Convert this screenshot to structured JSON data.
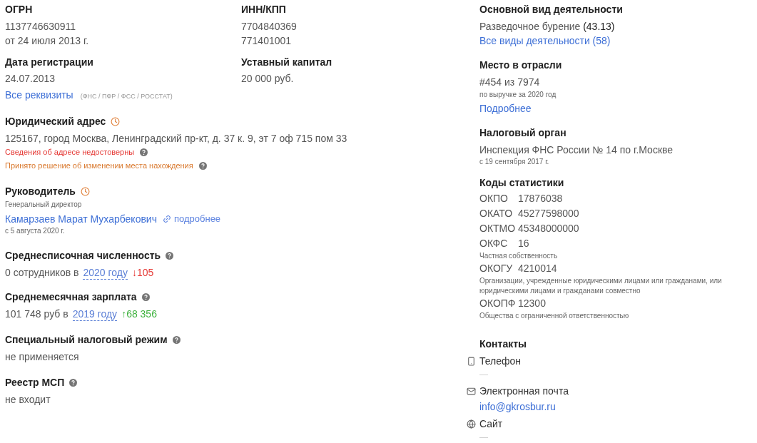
{
  "ogrn": {
    "label": "ОГРН",
    "value": "1137746630911",
    "date": "от 24 июля 2013 г."
  },
  "inn_kpp": {
    "label": "ИНН/КПП",
    "inn": "7704840369",
    "kpp": "771401001"
  },
  "registration": {
    "label": "Дата регистрации",
    "value": "24.07.2013"
  },
  "capital": {
    "label": "Уставный капитал",
    "value": "20 000 руб."
  },
  "requisites": {
    "link": "Все реквизиты",
    "sources": "(ФНС / ПФР / ФСС / РОССТАТ)"
  },
  "address": {
    "label": "Юридический адрес",
    "value": "125167, город Москва, Ленинградский пр-кт, д. 37 к. 9, эт 7 оф 715 пом 33",
    "warnings": [
      {
        "text": "Сведения об адресе недостоверны",
        "color": "#e53935"
      },
      {
        "text": "Принято решение об изменении места нахождения",
        "color": "#d9782d"
      }
    ]
  },
  "director": {
    "label": "Руководитель",
    "position": "Генеральный директор",
    "name": "Камарзаев Марат Мухарбекович",
    "more": "подробнее",
    "since": "с 5 августа 2020 г."
  },
  "metrics": [
    {
      "label": "Среднесписочная численность",
      "prefix": "0 сотрудников в",
      "year": "2020 году",
      "delta": "↓105",
      "color": "#e53935"
    },
    {
      "label": "Среднемесячная зарплата",
      "prefix": "101 748 руб в",
      "year": "2019 году",
      "delta": "↑68 356",
      "color": "#3fb23f"
    }
  ],
  "simple_sections": [
    {
      "label": "Специальный налоговый режим",
      "value": "не применяется"
    },
    {
      "label": "Реестр МСП",
      "value": "не входит"
    }
  ],
  "activity": {
    "label": "Основной вид деятельности",
    "value": "Разведочное бурение",
    "code": "(43.13)",
    "link": "Все виды деятельности (58)"
  },
  "rank": {
    "label": "Место в отрасли",
    "value": "#454 из 7974",
    "note": "по выручке за 2020 год",
    "link": "Подробнее"
  },
  "tax_authority": {
    "label": "Налоговый орган",
    "value": "Инспекция ФНС России № 14 по г.Москве",
    "since": "с 19 сентября 2017 г."
  },
  "stat_codes": {
    "label": "Коды статистики",
    "codes": [
      {
        "code": "ОКПО",
        "value": "17876038"
      },
      {
        "code": "ОКАТО",
        "value": "45277598000"
      },
      {
        "code": "ОКТМО",
        "value": "45348000000"
      },
      {
        "code": "ОКФС",
        "value": "16",
        "note": "Частная собственность"
      },
      {
        "code": "ОКОГУ",
        "value": "4210014",
        "note": "Организации, учрежденные юридическими лицами или гражданами, или юридическими лицами и гражданами совместно"
      },
      {
        "code": "ОКОПФ",
        "value": "12300",
        "note": "Общества с ограниченной ответственностью"
      }
    ]
  },
  "contacts": {
    "label": "Контакты",
    "items": [
      {
        "kind": "phone",
        "label": "Телефон",
        "value": "—"
      },
      {
        "kind": "email",
        "label": "Электронная почта",
        "value": "info@gkrosbur.ru"
      },
      {
        "kind": "site",
        "label": "Сайт",
        "value": "—"
      }
    ]
  }
}
